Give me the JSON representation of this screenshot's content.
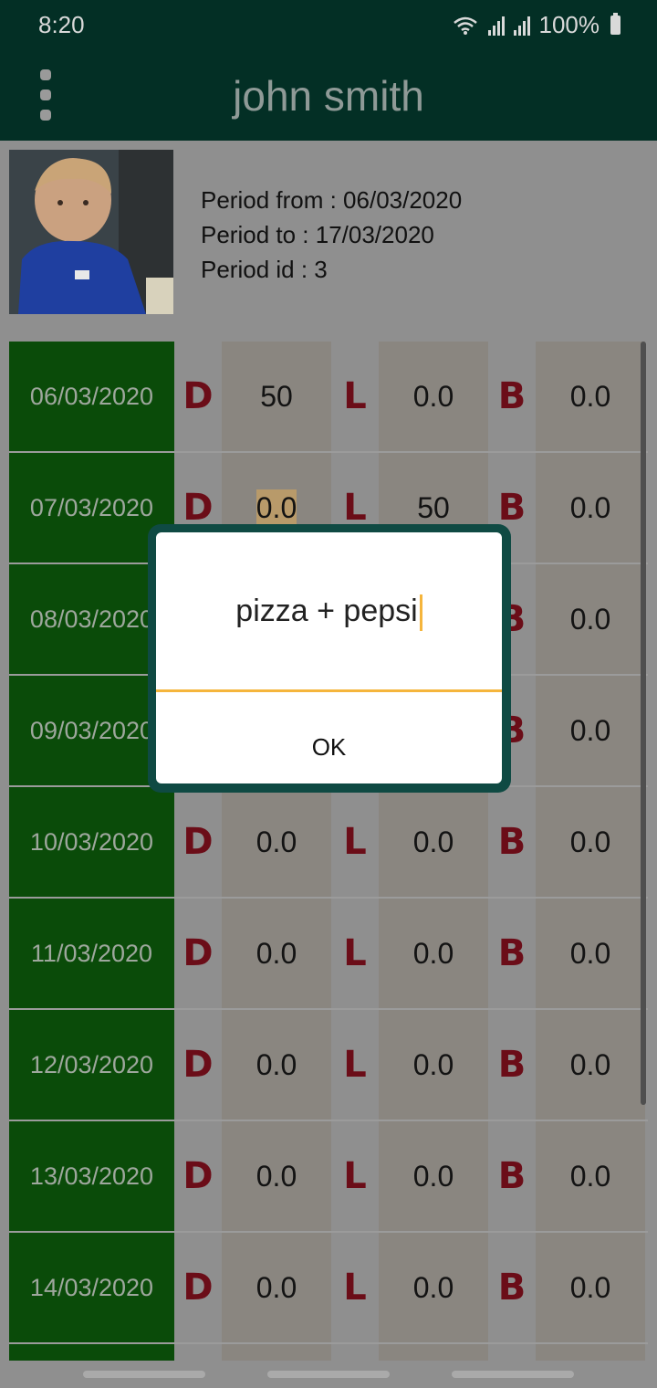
{
  "status": {
    "time": "8:20",
    "battery": "100%"
  },
  "header": {
    "title": "john smith"
  },
  "period": {
    "from": "Period from : 06/03/2020",
    "to": "Period to : 17/03/2020",
    "id": "Period id : 3"
  },
  "labels": {
    "d": "D",
    "l": "L",
    "b": "B"
  },
  "rows": [
    {
      "date": "06/03/2020",
      "d": "50",
      "l": "0.0",
      "b": "0.0"
    },
    {
      "date": "07/03/2020",
      "d": "0.0",
      "l": "50",
      "b": "0.0"
    },
    {
      "date": "08/03/2020",
      "d": "",
      "l": "",
      "b": "0.0"
    },
    {
      "date": "09/03/2020",
      "d": "",
      "l": "",
      "b": "0.0"
    },
    {
      "date": "10/03/2020",
      "d": "0.0",
      "l": "0.0",
      "b": "0.0"
    },
    {
      "date": "11/03/2020",
      "d": "0.0",
      "l": "0.0",
      "b": "0.0"
    },
    {
      "date": "12/03/2020",
      "d": "0.0",
      "l": "0.0",
      "b": "0.0"
    },
    {
      "date": "13/03/2020",
      "d": "0.0",
      "l": "0.0",
      "b": "0.0"
    },
    {
      "date": "14/03/2020",
      "d": "0.0",
      "l": "0.0",
      "b": "0.0"
    }
  ],
  "dialog": {
    "input_value": "pizza + pepsi",
    "ok_label": "OK"
  },
  "colors": {
    "appbar": "#032f25",
    "date_cell": "#0a4b09",
    "letter": "#6b0d18",
    "accent": "#f5b53c"
  }
}
